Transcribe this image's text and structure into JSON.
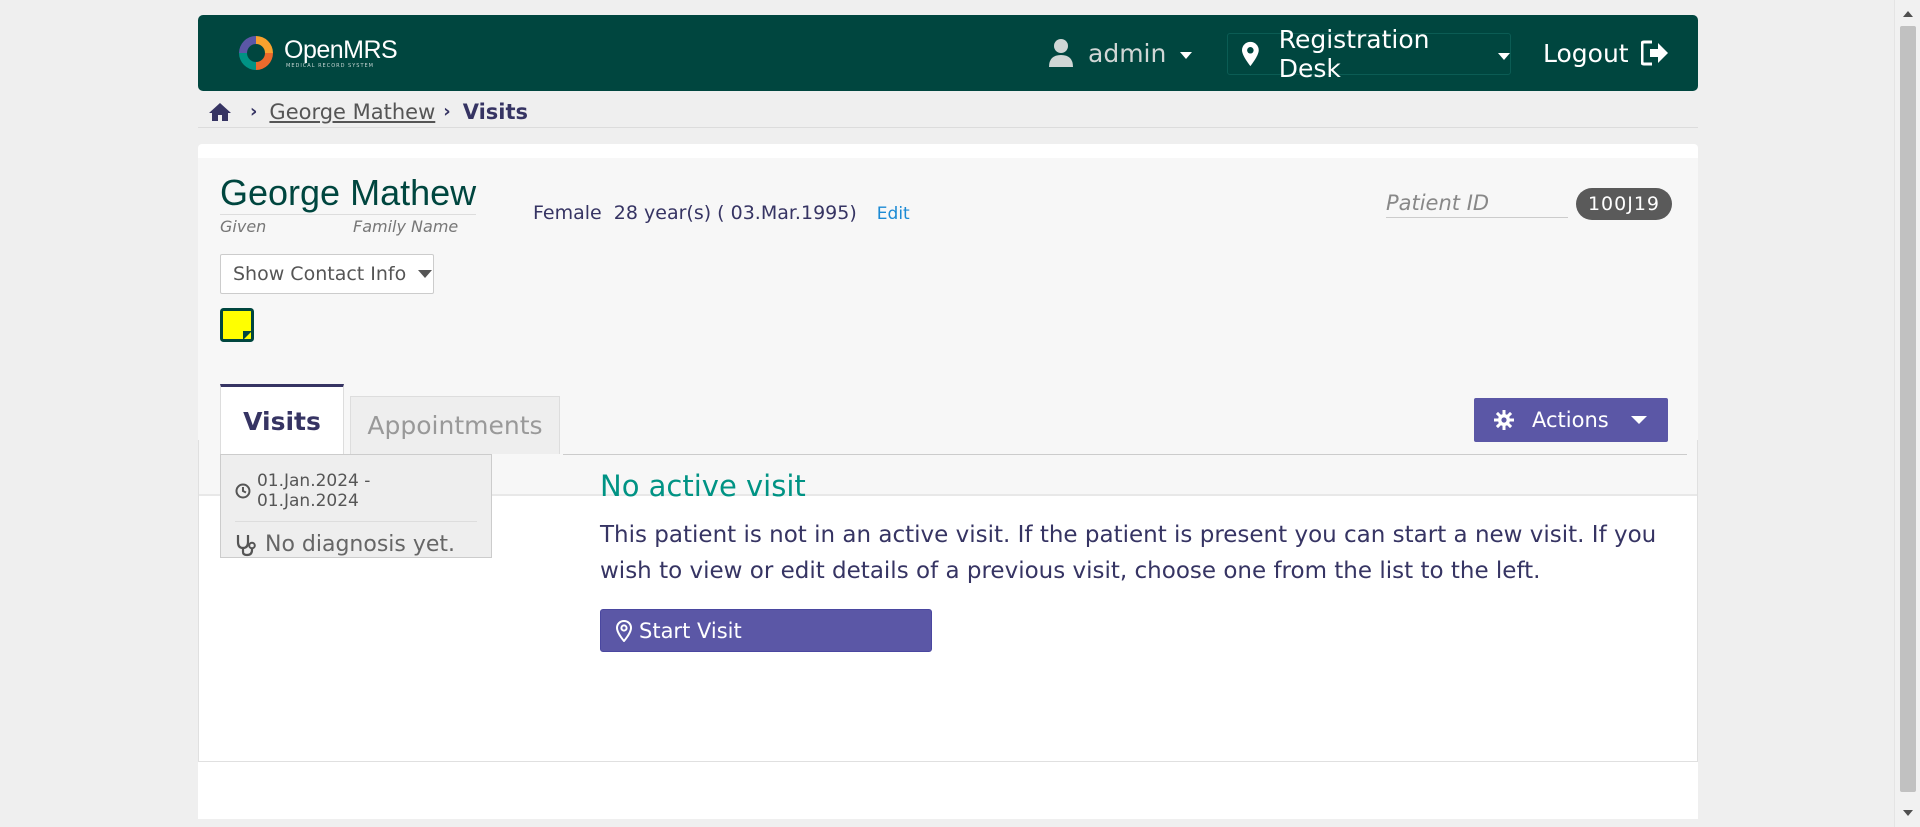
{
  "header": {
    "logo_text": "OpenMRS",
    "logo_subtitle": "MEDICAL RECORD SYSTEM",
    "user": "admin",
    "location": "Registration Desk",
    "logout": "Logout"
  },
  "breadcrumb": {
    "home_icon": "home-icon",
    "patient": "George Mathew ",
    "current": "Visits"
  },
  "patient": {
    "given_name": "George",
    "family_name": "Mathew",
    "given_label": "Given",
    "family_label": "Family Name",
    "gender": "Female",
    "age": "28 year(s) ( 03.Mar.1995)",
    "edit_label": "Edit",
    "id_label": "Patient ID",
    "id_value": "100J19",
    "contact_button": "Show Contact Info"
  },
  "tabs": [
    {
      "label": "Visits",
      "active": true
    },
    {
      "label": "Appointments",
      "active": false
    }
  ],
  "actions_label": "Actions",
  "visits": [
    {
      "date_range": "01.Jan.2024 - 01.Jan.2024",
      "diagnosis": "No diagnosis yet."
    }
  ],
  "main": {
    "title": "No active visit",
    "body": "This patient is not in an active visit. If the patient is present you can start a new visit. If you wish to view or edit details of a previous visit, choose one from the list to the left.",
    "start_button": "Start Visit"
  },
  "colors": {
    "header_bg": "#00463f",
    "accent_purple": "#5b57a6",
    "title_teal": "#009384",
    "sticky_note": "#ffff00"
  }
}
